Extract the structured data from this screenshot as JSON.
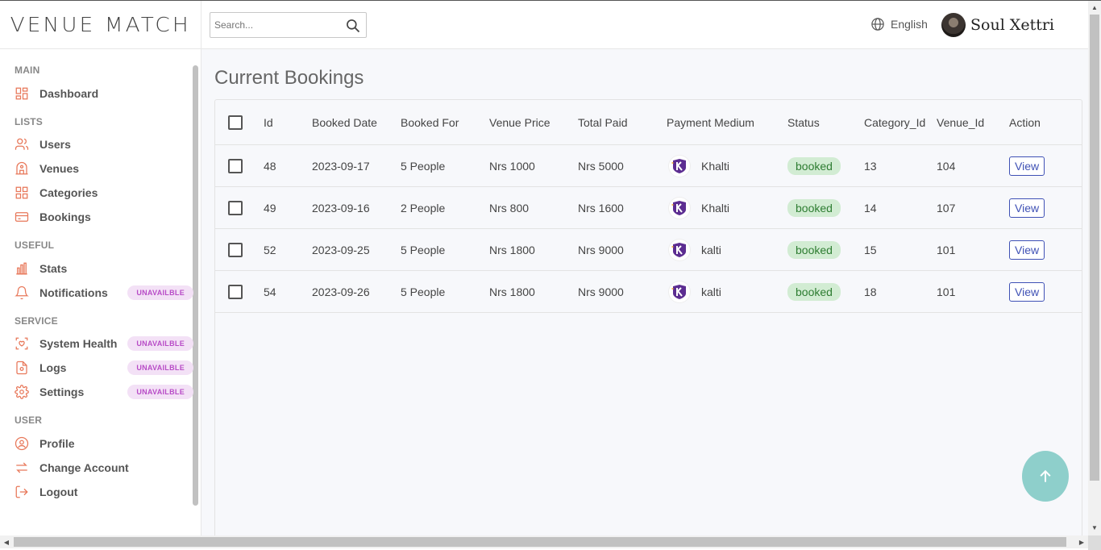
{
  "brand": {
    "logo_text": "VENUE MATCH"
  },
  "header": {
    "search_placeholder": "Search...",
    "language": "English",
    "user_name": "Soul Xettri"
  },
  "sidebar": {
    "sections": {
      "main": "MAIN",
      "lists": "LISTS",
      "useful": "USEFUL",
      "service": "SERVICE",
      "user": "USER"
    },
    "items": {
      "dashboard": "Dashboard",
      "users": "Users",
      "venues": "Venues",
      "categories": "Categories",
      "bookings": "Bookings",
      "stats": "Stats",
      "notifications": "Notifications",
      "system_health": "System Health",
      "logs": "Logs",
      "settings": "Settings",
      "profile": "Profile",
      "change_account": "Change Account",
      "logout": "Logout"
    },
    "badge_label": "UNAVAILBLE"
  },
  "main": {
    "title": "Current Bookings",
    "columns": [
      "Id",
      "Booked Date",
      "Booked For",
      "Venue Price",
      "Total Paid",
      "Payment Medium",
      "Status",
      "Category_Id",
      "Venue_Id",
      "Action"
    ],
    "rows": [
      {
        "id": "48",
        "date": "2023-09-17",
        "for": "5 People",
        "price": "Nrs 1000",
        "paid": "Nrs 5000",
        "medium": "Khalti",
        "status": "booked",
        "category": "13",
        "venue": "104",
        "action": "View"
      },
      {
        "id": "49",
        "date": "2023-09-16",
        "for": "2 People",
        "price": "Nrs 800",
        "paid": "Nrs 1600",
        "medium": "Khalti",
        "status": "booked",
        "category": "14",
        "venue": "107",
        "action": "View"
      },
      {
        "id": "52",
        "date": "2023-09-25",
        "for": "5 People",
        "price": "Nrs 1800",
        "paid": "Nrs 9000",
        "medium": "kalti",
        "status": "booked",
        "category": "15",
        "venue": "101",
        "action": "View"
      },
      {
        "id": "54",
        "date": "2023-09-26",
        "for": "5 People",
        "price": "Nrs 1800",
        "paid": "Nrs 9000",
        "medium": "kalti",
        "status": "booked",
        "category": "18",
        "venue": "101",
        "action": "View"
      }
    ]
  },
  "colors": {
    "accent": "#e8785a",
    "badge_bg": "#f3e1f6",
    "badge_text": "#b84cc7",
    "status_bg": "#d2ecd3",
    "status_text": "#2e7d32",
    "view_button": "#3f51b5",
    "fab": "#8ecfcb",
    "khalti": "#5c2d91"
  }
}
